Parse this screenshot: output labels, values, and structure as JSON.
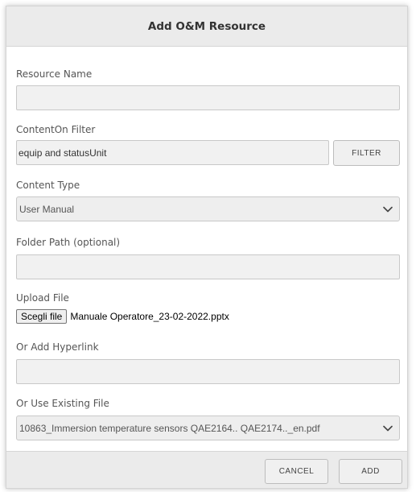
{
  "dialog": {
    "title": "Add O&M Resource"
  },
  "form": {
    "resource_name": {
      "label": "Resource Name",
      "value": ""
    },
    "contenton_filter": {
      "label": "ContentOn Filter",
      "value": "equip and statusUnit",
      "button_label": "FILTER"
    },
    "content_type": {
      "label": "Content Type",
      "selected": "User Manual"
    },
    "folder_path": {
      "label": "Folder Path (optional)",
      "value": ""
    },
    "upload_file": {
      "label": "Upload File",
      "button_label": "Scegli file",
      "file_name": "Manuale Operatore_23-02-2022.pptx"
    },
    "hyperlink": {
      "label": "Or Add Hyperlink",
      "value": ""
    },
    "existing_file": {
      "label": "Or Use Existing File",
      "selected": "10863_Immersion temperature sensors QAE2164.. QAE2174.._en.pdf"
    }
  },
  "footer": {
    "cancel_label": "CANCEL",
    "add_label": "ADD"
  },
  "icons": {
    "select_chevron": "chevron-down-icon"
  },
  "colors": {
    "header_bg": "#ebebeb",
    "input_bg": "#f1f1f1",
    "border": "#c8c8c8"
  }
}
